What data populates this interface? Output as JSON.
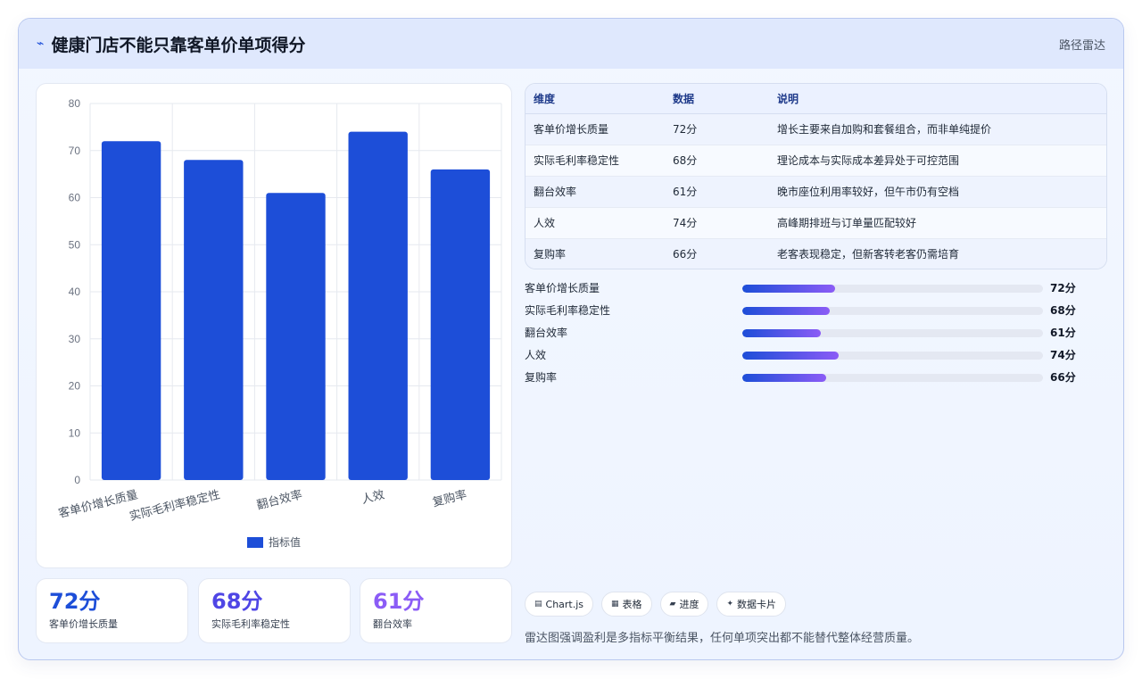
{
  "header": {
    "icon": "pulse-icon",
    "title": "健康门店不能只靠客单价单项得分",
    "right_label": "路径雷达"
  },
  "chart_data": {
    "type": "bar",
    "categories": [
      "客单价增长质量",
      "实际毛利率稳定性",
      "翻台效率",
      "人效",
      "复购率"
    ],
    "series": [
      {
        "name": "指标值",
        "values": [
          72,
          68,
          61,
          74,
          66
        ],
        "color": "#1d4ed8"
      }
    ],
    "ylim": [
      0,
      80
    ],
    "yticks": [
      0,
      10,
      20,
      30,
      40,
      50,
      60,
      70,
      80
    ],
    "grid": true,
    "legend_position": "bottom"
  },
  "stats": [
    {
      "value": "72分",
      "label": "客单价增长质量",
      "color": "#1d4ed8"
    },
    {
      "value": "68分",
      "label": "实际毛利率稳定性",
      "color": "#4f46e5"
    },
    {
      "value": "61分",
      "label": "翻台效率",
      "color": "#8b5cf6"
    }
  ],
  "table": {
    "headers": [
      "维度",
      "数据",
      "说明"
    ],
    "rows": [
      [
        "客单价增长质量",
        "72分",
        "增长主要来自加购和套餐组合，而非单纯提价"
      ],
      [
        "实际毛利率稳定性",
        "68分",
        "理论成本与实际成本差异处于可控范围"
      ],
      [
        "翻台效率",
        "61分",
        "晚市座位利用率较好，但午市仍有空档"
      ],
      [
        "人效",
        "74分",
        "高峰期排班与订单量匹配较好"
      ],
      [
        "复购率",
        "66分",
        "老客表现稳定，但新客转老客仍需培育"
      ]
    ]
  },
  "progress": [
    {
      "label": "客单价增长质量",
      "value_text": "72分",
      "fraction": 0.31
    },
    {
      "label": "实际毛利率稳定性",
      "value_text": "68分",
      "fraction": 0.29
    },
    {
      "label": "翻台效率",
      "value_text": "61分",
      "fraction": 0.26
    },
    {
      "label": "人效",
      "value_text": "74分",
      "fraction": 0.32
    },
    {
      "label": "复购率",
      "value_text": "66分",
      "fraction": 0.28
    }
  ],
  "chips": [
    {
      "icon": "grid-icon",
      "glyph": "▤",
      "label": "Chart.js"
    },
    {
      "icon": "table-icon",
      "glyph": "▦",
      "label": "表格"
    },
    {
      "icon": "progress-icon",
      "glyph": "▰",
      "label": "进度"
    },
    {
      "icon": "sparkle-icon",
      "glyph": "✦",
      "label": "数据卡片"
    }
  ],
  "footnote": "雷达图强调盈利是多指标平衡结果，任何单项突出都不能替代整体经营质量。"
}
